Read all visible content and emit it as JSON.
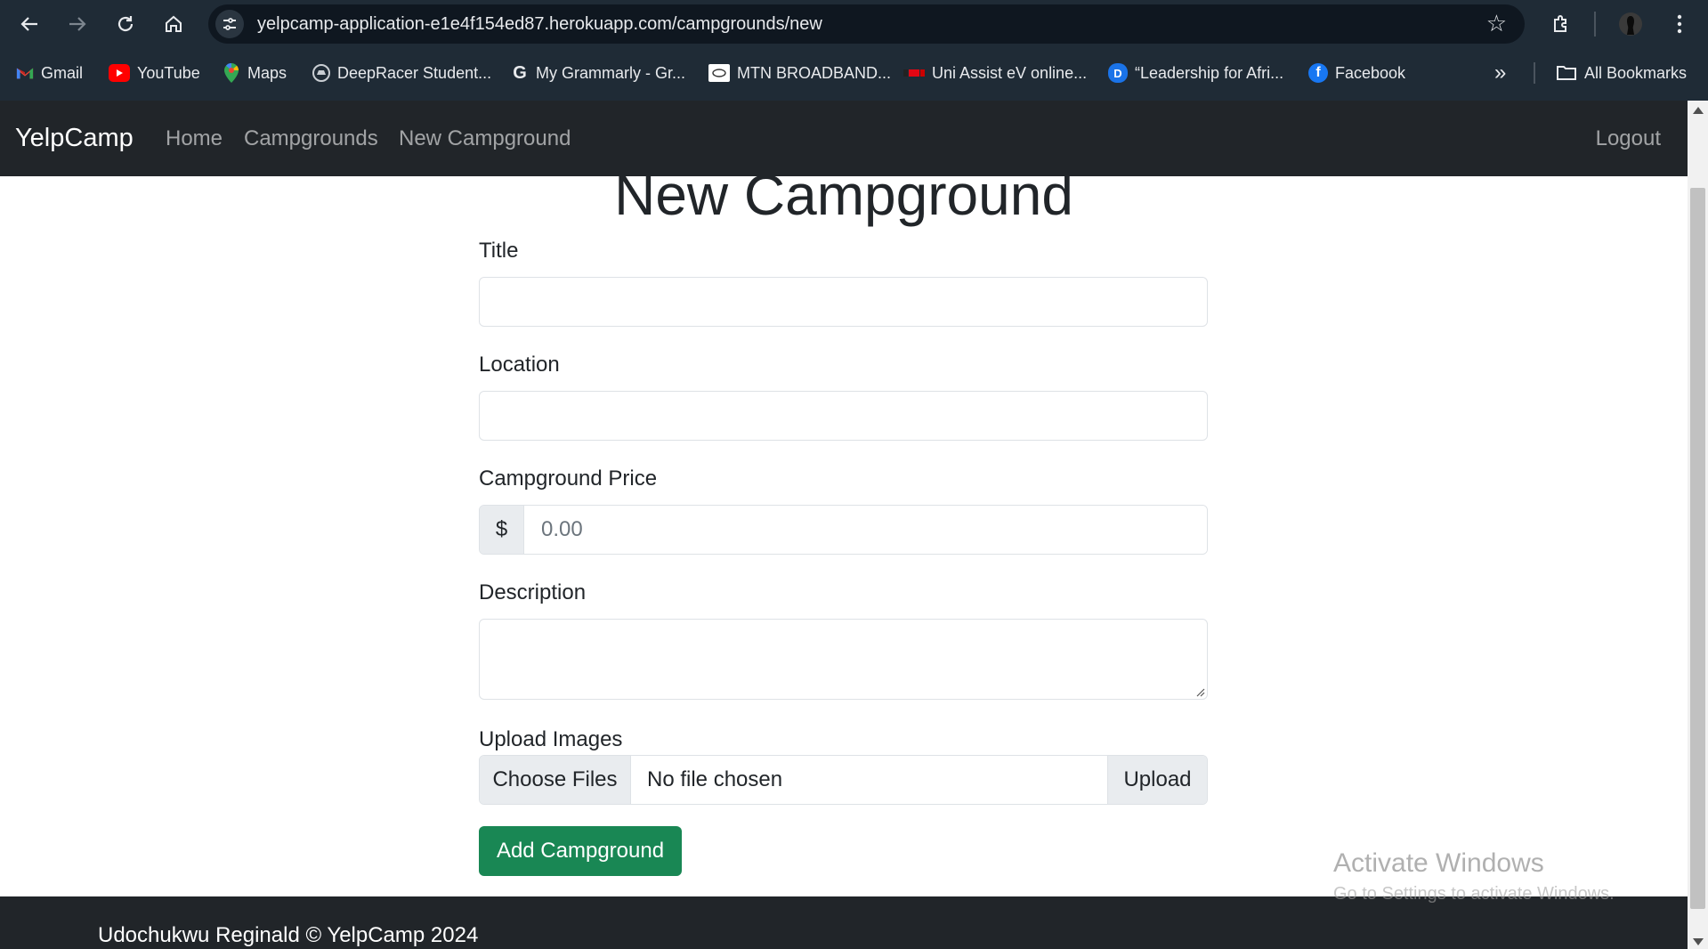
{
  "browser": {
    "url": "yelpcamp-application-e1e4f154ed87.herokuapp.com/campgrounds/new",
    "bookmarks": [
      {
        "label": "Gmail",
        "icon": "gmail-icon"
      },
      {
        "label": "YouTube",
        "icon": "youtube-icon"
      },
      {
        "label": "Maps",
        "icon": "maps-icon"
      },
      {
        "label": "DeepRacer Student...",
        "icon": "deepracer-icon"
      },
      {
        "label": "My Grammarly - Gr...",
        "icon": "grammarly-icon"
      },
      {
        "label": "MTN BROADBAND...",
        "icon": "mtn-icon"
      },
      {
        "label": "Uni Assist eV online...",
        "icon": "uni-assist-icon"
      },
      {
        "label": "“Leadership for Afri...",
        "icon": "d-letter-icon"
      },
      {
        "label": "Facebook",
        "icon": "facebook-icon"
      }
    ],
    "all_bookmarks": "All Bookmarks",
    "more_glyph": "»"
  },
  "navbar": {
    "brand": "YelpCamp",
    "links": [
      "Home",
      "Campgrounds",
      "New Campground"
    ],
    "logout": "Logout"
  },
  "form": {
    "heading": "New Campground",
    "title_label": "Title",
    "location_label": "Location",
    "price_label": "Campground Price",
    "price_prefix": "$",
    "price_placeholder": "0.00",
    "description_label": "Description",
    "upload_label": "Upload Images",
    "choose_files": "Choose Files",
    "no_file": "No file chosen",
    "upload": "Upload",
    "submit": "Add Campground",
    "submit_color": "#198754"
  },
  "footer": {
    "text": "Udochukwu Reginald © YelpCamp 2024"
  },
  "watermark": {
    "title": "Activate Windows",
    "subtitle": "Go to Settings to activate Windows."
  }
}
